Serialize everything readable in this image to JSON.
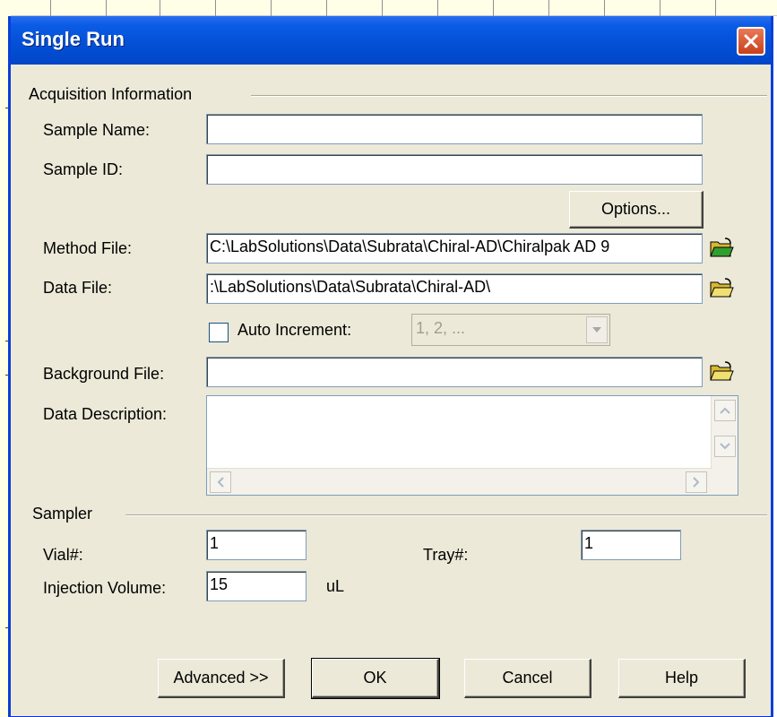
{
  "window": {
    "title": "Single Run"
  },
  "acquisition": {
    "group_label": "Acquisition Information",
    "sample_name_label": "Sample Name:",
    "sample_name_value": "",
    "sample_id_label": "Sample ID:",
    "sample_id_value": "",
    "options_label": "Options...",
    "method_file_label": "Method File:",
    "method_file_value": "C:\\LabSolutions\\Data\\Subrata\\Chiral-AD\\Chiralpak AD 9",
    "data_file_label": "Data File:",
    "data_file_value": ":\\LabSolutions\\Data\\Subrata\\Chiral-AD\\",
    "auto_increment_label": "Auto Increment:",
    "auto_increment_checked": false,
    "auto_increment_value": "1, 2, ...",
    "background_file_label": "Background File:",
    "background_file_value": "",
    "data_description_label": "Data Description:",
    "data_description_value": ""
  },
  "sampler": {
    "group_label": "Sampler",
    "vial_label": "Vial#:",
    "vial_value": "1",
    "tray_label": "Tray#:",
    "tray_value": "1",
    "injection_label": "Injection Volume:",
    "injection_value": "15",
    "injection_unit": "uL"
  },
  "buttons": {
    "advanced": "Advanced >>",
    "ok": "OK",
    "cancel": "Cancel",
    "help": "Help"
  },
  "icons": {
    "close": "close-icon",
    "open_folder": "open-folder-icon"
  },
  "colors": {
    "titlebar": "#0450d7",
    "dialog_bg": "#ece9d8",
    "close_btn": "#c8401b",
    "folder_yellow": "#e8d24a",
    "folder_arrow": "#2f9e2f"
  }
}
